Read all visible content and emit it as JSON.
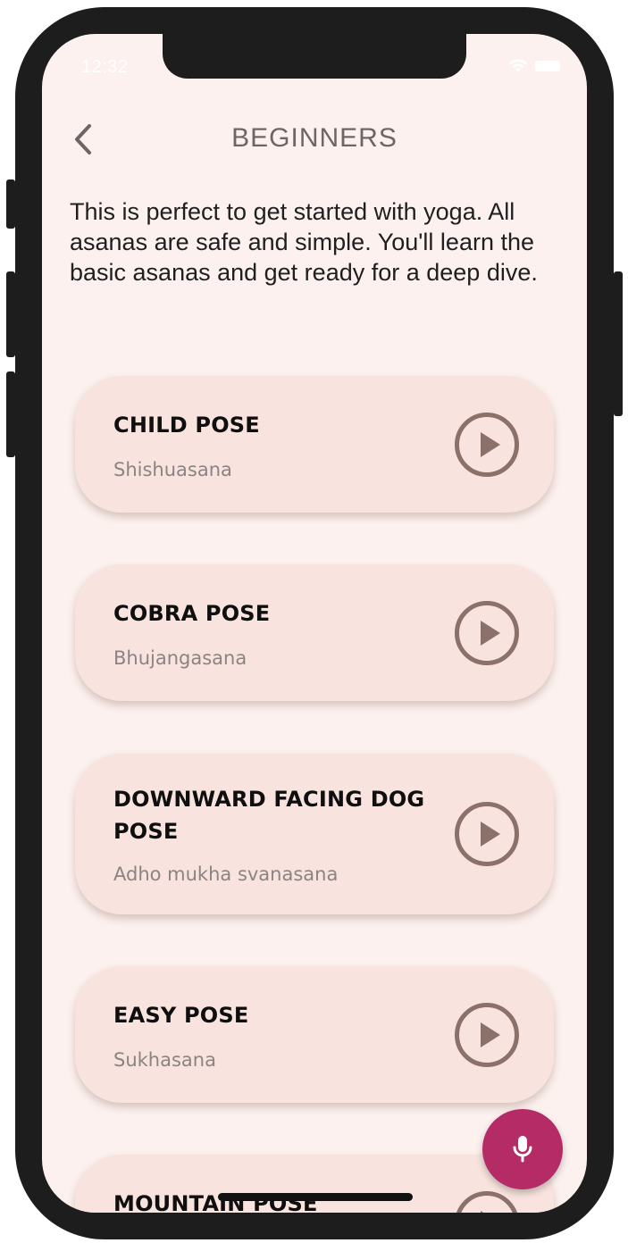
{
  "status_bar": {
    "time": "12:32",
    "wifi_icon": "wifi-icon",
    "battery_icon": "battery-icon"
  },
  "header": {
    "back_icon": "chevron-left-icon",
    "title": "BEGINNERS"
  },
  "description": "This is perfect to get started with yoga. All asanas are safe and simple. You'll learn the basic asanas and get ready for a deep dive.",
  "poses": [
    {
      "name": "CHILD POSE",
      "sanskrit": "Shishuasana"
    },
    {
      "name": "COBRA POSE",
      "sanskrit": "Bhujangasana"
    },
    {
      "name": "DOWNWARD FACING DOG POSE",
      "sanskrit": "Adho mukha svanasana"
    },
    {
      "name": "EASY POSE",
      "sanskrit": "Sukhasana"
    },
    {
      "name": "MOUNTAIN POSE",
      "sanskrit": ""
    }
  ],
  "play_icon": "play-circle-icon",
  "fab": {
    "icon": "microphone-icon"
  },
  "colors": {
    "background": "#fcf1ee",
    "card": "#f8e3de",
    "accent": "#b42b66",
    "play_icon": "#8b7169",
    "title": "#6e6666"
  }
}
